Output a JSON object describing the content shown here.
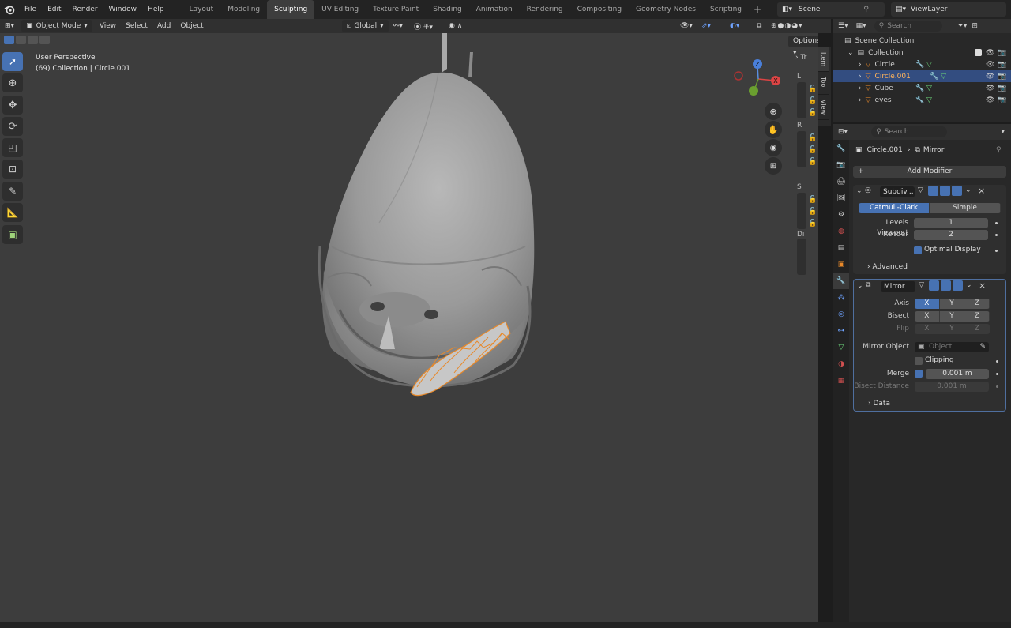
{
  "menu": [
    "File",
    "Edit",
    "Render",
    "Window",
    "Help"
  ],
  "workspaces": [
    "Layout",
    "Modeling",
    "Sculpting",
    "UV Editing",
    "Texture Paint",
    "Shading",
    "Animation",
    "Rendering",
    "Compositing",
    "Geometry Nodes",
    "Scripting"
  ],
  "active_workspace": "Sculpting",
  "scene": "Scene",
  "view_layer": "ViewLayer",
  "viewport_header": {
    "mode": "Object Mode",
    "view": "View",
    "select": "Select",
    "add": "Add",
    "object": "Object",
    "orientation": "Global",
    "options": "Options"
  },
  "overlay": {
    "perspective": "User Perspective",
    "info": "(69) Collection | Circle.001"
  },
  "side_tabs": [
    "Item",
    "Tool",
    "View"
  ],
  "npanel": {
    "header": "Tr",
    "labels": [
      "L",
      "R",
      "S",
      "Di"
    ]
  },
  "gizmo": {
    "x": "X",
    "y": "Y",
    "z": "Z"
  },
  "outliner": {
    "search": "Search",
    "root": "Scene Collection",
    "collection": "Collection",
    "items": [
      {
        "name": "Circle",
        "selected": false
      },
      {
        "name": "Circle.001",
        "selected": true
      },
      {
        "name": "Cube",
        "selected": false
      },
      {
        "name": "eyes",
        "selected": false
      }
    ]
  },
  "properties": {
    "search": "Search",
    "breadcrumb_object": "Circle.001",
    "breadcrumb_modifier": "Mirror",
    "add_modifier": "Add Modifier",
    "subdiv": {
      "name": "Subdiv...",
      "catmull": "Catmull-Clark",
      "simple": "Simple",
      "levels_label": "Levels Viewport",
      "levels_value": "1",
      "render_label": "Render",
      "render_value": "2",
      "optimal": "Optimal Display",
      "advanced": "Advanced"
    },
    "mirror": {
      "name": "Mirror",
      "axis_label": "Axis",
      "bisect_label": "Bisect",
      "flip_label": "Flip",
      "x": "X",
      "y": "Y",
      "z": "Z",
      "mirror_object_label": "Mirror Object",
      "object_placeholder": "Object",
      "clipping": "Clipping",
      "merge_label": "Merge",
      "merge_value": "0.001 m",
      "bisect_distance_label": "Bisect Distance",
      "bisect_distance_value": "0.001 m",
      "data": "Data"
    }
  },
  "colors": {
    "accent": "#4772b3",
    "selection_outline": "#e8892a",
    "viewport_bg": "#3d3d3d"
  }
}
